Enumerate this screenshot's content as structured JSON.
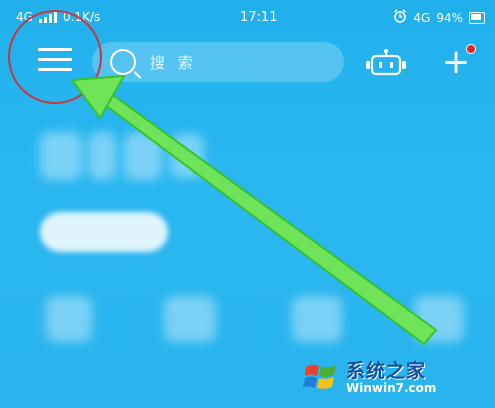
{
  "status_bar": {
    "network_label": "4G",
    "speed": "0.1K/s",
    "time": "17:11",
    "network_label_right": "4G",
    "battery": "94%"
  },
  "header": {
    "search_placeholder": "搜 索"
  },
  "watermark": {
    "site_name": "系统之家",
    "url": "Winwin7.com"
  }
}
